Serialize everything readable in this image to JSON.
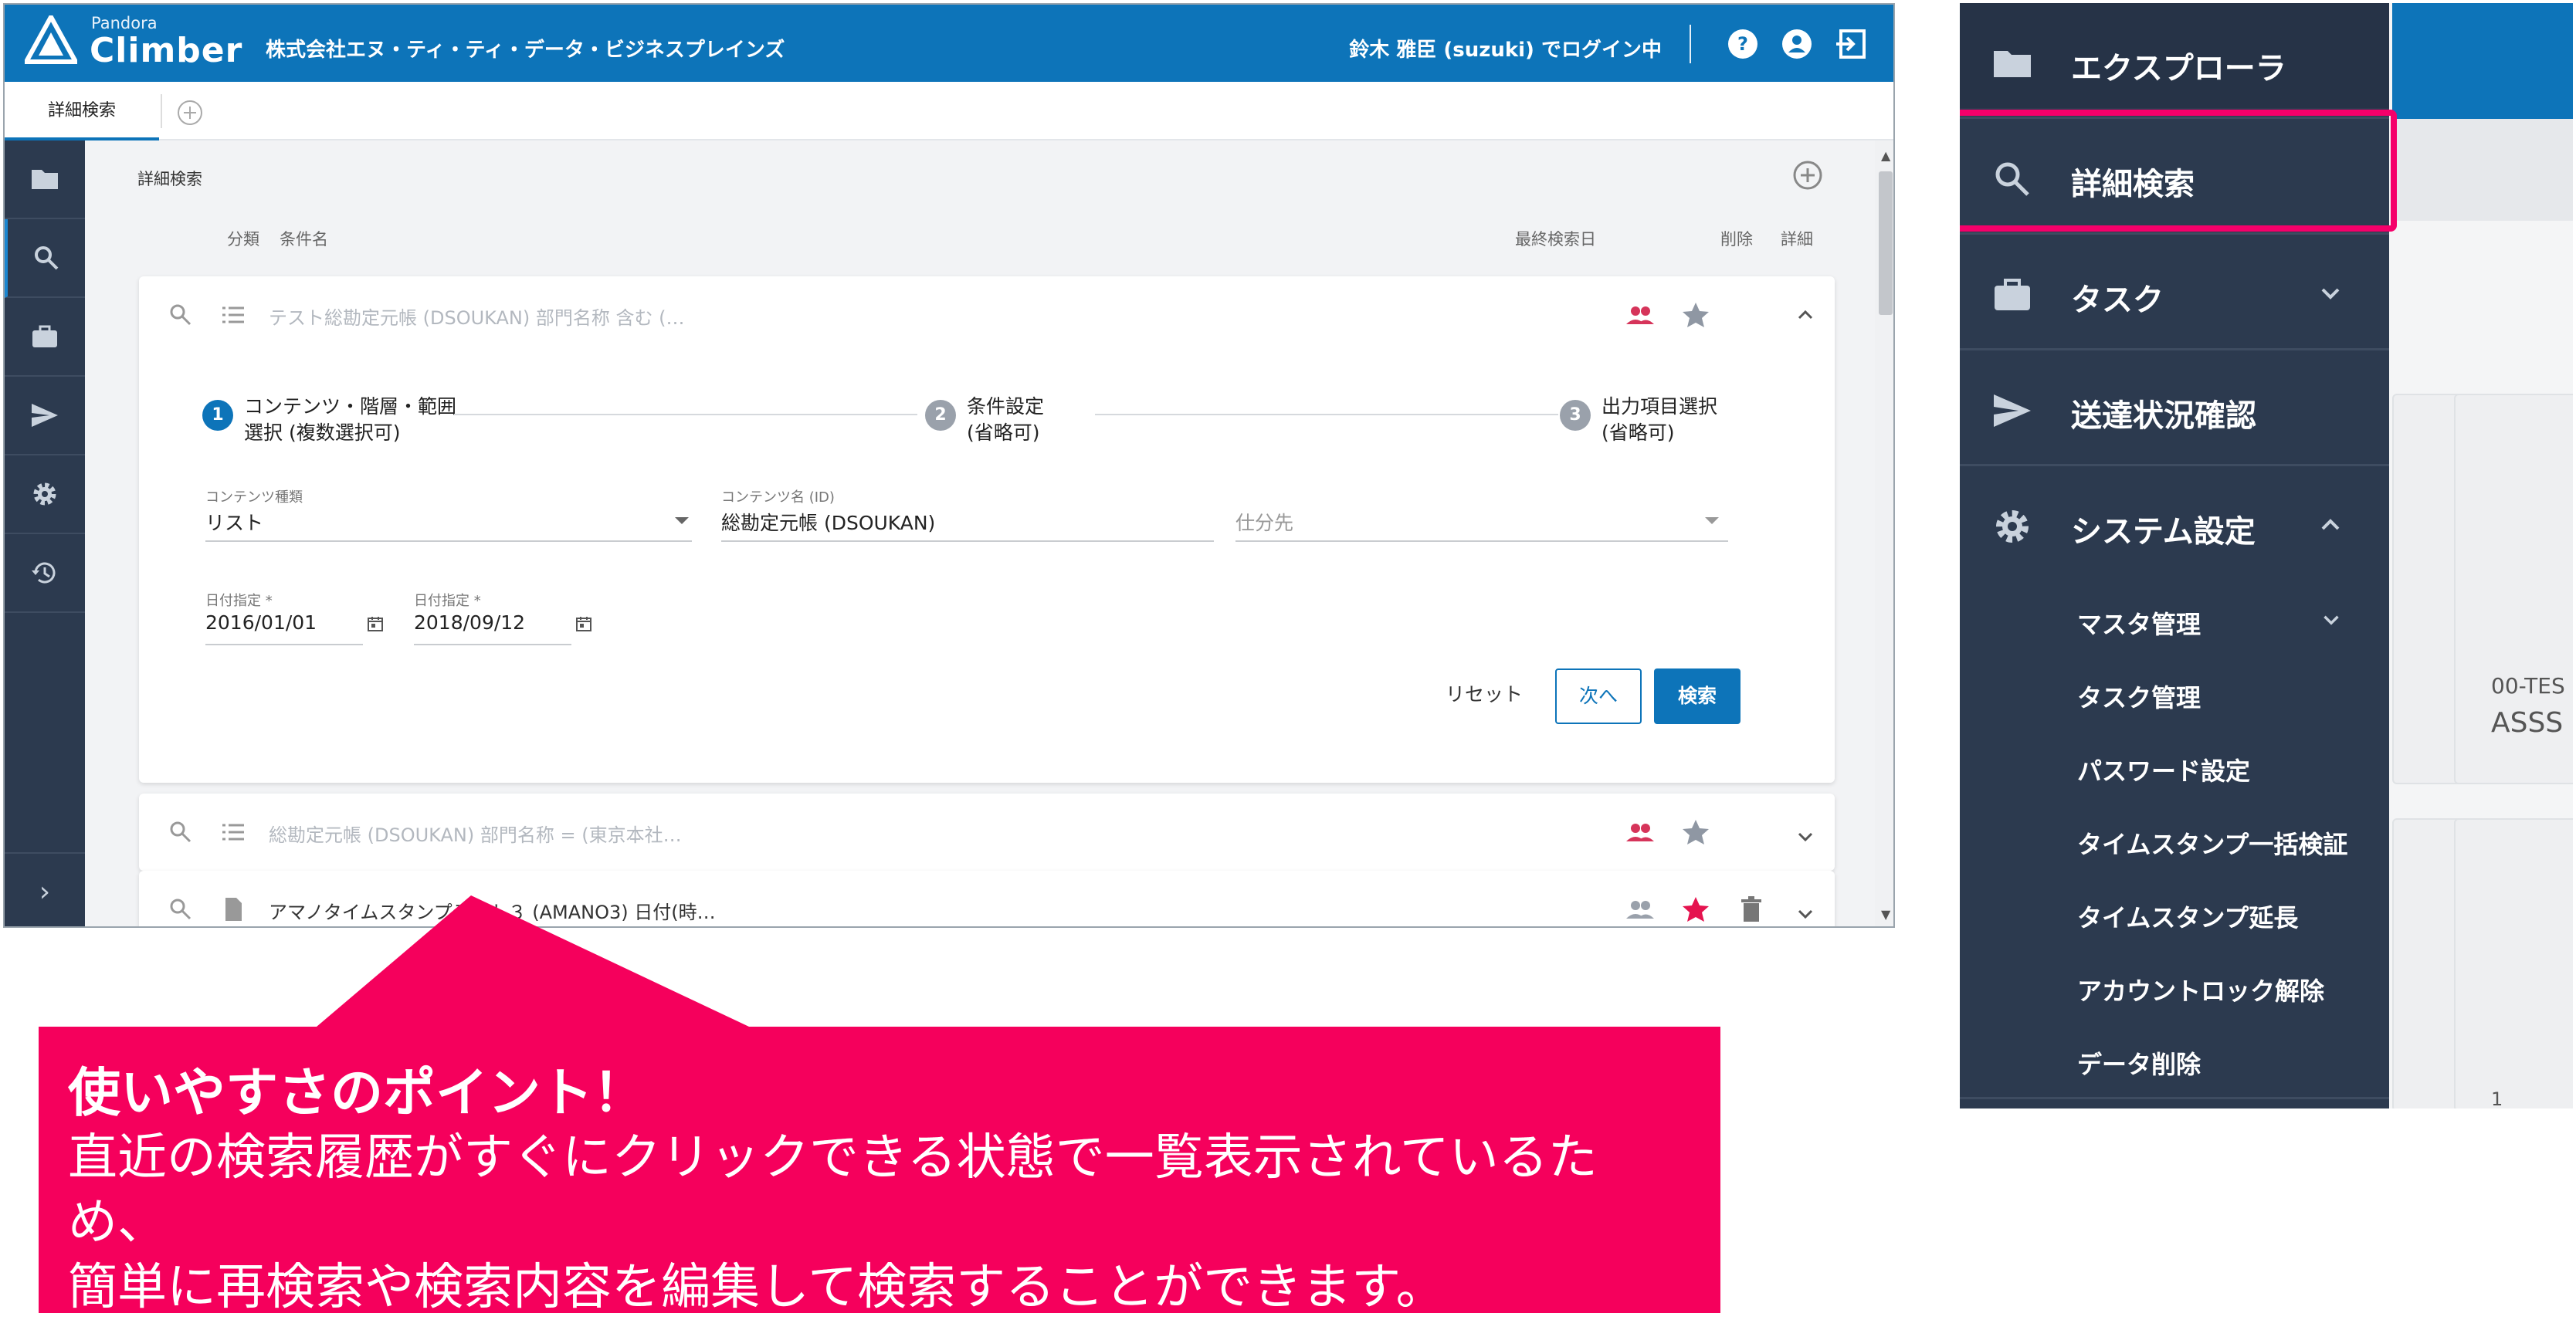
{
  "app": {
    "brand_small": "Pandora",
    "brand": "Climber",
    "company": "株式会社エヌ・ティ・ティ・データ・ビジネスプレインズ",
    "login": "鈴木 雅臣 (suzuki) でログイン中",
    "accent": "#0d74b9",
    "sidebar_bg": "#2c3a4f",
    "tab_label": "詳細検索"
  },
  "main": {
    "title": "詳細検索",
    "headers": {
      "category": "分類",
      "condition": "条件名",
      "last_search": "最終検索日",
      "delete": "削除",
      "detail": "詳細"
    }
  },
  "expanded_row": {
    "text": "テスト総勘定元帳 (DSOUKAN)  部門名称 含む (…",
    "steps": [
      {
        "num": "1",
        "label_1": "コンテンツ・階層・範囲",
        "label_2": "選択 (複数選択可)"
      },
      {
        "num": "2",
        "label_1": "条件設定",
        "label_2": "(省略可)"
      },
      {
        "num": "3",
        "label_1": "出力項目選択",
        "label_2": "(省略可)"
      }
    ],
    "fields": {
      "content_type_label": "コンテンツ種類",
      "content_type_value": "リスト",
      "content_name_label": "コンテンツ名 (ID)",
      "content_name_value": "総勘定元帳 (DSOUKAN)",
      "sort_placeholder": "仕分先",
      "date_from_label": "日付指定 *",
      "date_from_value": "2016/01/01",
      "date_to_label": "日付指定 *",
      "date_to_value": "2018/09/12"
    },
    "buttons": {
      "reset": "リセット",
      "next": "次へ",
      "search": "検索"
    }
  },
  "rows": [
    {
      "text": "総勘定元帳 (DSOUKAN)  部門名称 = (東京本社…"
    },
    {
      "text": "アマノタイムスタンプテスト３ (AMANO3)  日付(時…"
    }
  ],
  "callout": {
    "title": "使いやすさのポイント！",
    "line1": "直近の検索履歴がすぐにクリックできる状態で一覧表示されているため、",
    "line2": "簡単に再検索や検索内容を編集して検索することができます。",
    "color": "#f5005c"
  },
  "menu": {
    "items": [
      {
        "label": "エクスプローラ",
        "icon": "folder-icon"
      },
      {
        "label": "詳細検索",
        "icon": "search-icon"
      },
      {
        "label": "タスク",
        "icon": "briefcase-icon"
      },
      {
        "label": "送達状況確認",
        "icon": "send-icon"
      },
      {
        "label": "システム設定",
        "icon": "gear-icon"
      }
    ],
    "sub_items": [
      "マスタ管理",
      "タスク管理",
      "パスワード設定",
      "タイムスタンプ一括検証",
      "タイムスタンプ延長",
      "アカウントロック解除",
      "データ削除"
    ],
    "highlight_color": "#f5006a",
    "background": {
      "card_code": "00-TES",
      "card_text": "ASSS",
      "card_num": "1"
    }
  }
}
